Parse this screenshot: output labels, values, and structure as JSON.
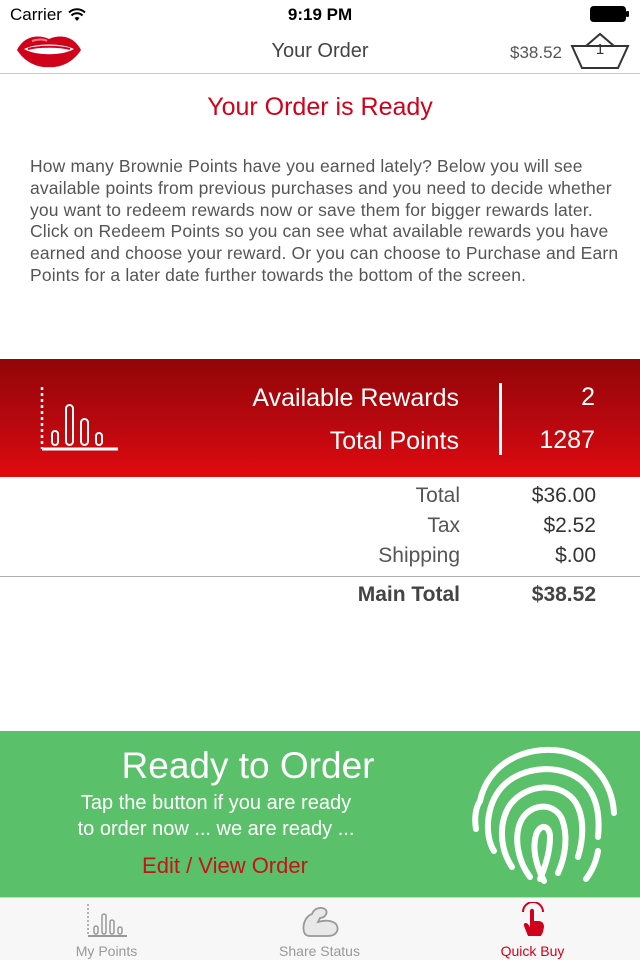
{
  "status_bar": {
    "carrier": "Carrier",
    "time": "9:19 PM"
  },
  "nav": {
    "title": "Your Order",
    "price": "$38.52",
    "cart_count": "1"
  },
  "heading": "Your Order is Ready",
  "intro": "How many Brownie Points have you earned lately? Below you will see available points from previous purchases and you need to decide whether you want to redeem rewards now or save them for bigger rewards later. Click on Redeem Points so you can see what available rewards you have earned and choose your reward. Or you can choose to Purchase and Earn Points for a later date further towards the bottom of the screen.",
  "rewards": {
    "available_label": "Available Rewards",
    "available_value": "2",
    "points_label": "Total Points",
    "points_value": "1287"
  },
  "summary": {
    "total_label": "Total",
    "total_value": "$36.00",
    "tax_label": "Tax",
    "tax_value": "$2.52",
    "shipping_label": "Shipping",
    "shipping_value": "$.00",
    "main_total_label": "Main Total",
    "main_total_value": "$38.52"
  },
  "order": {
    "title": "Ready to Order",
    "subtitle_line1": "Tap the button if you are ready",
    "subtitle_line2": "to order now ... we are ready ...",
    "edit_link": "Edit / View Order"
  },
  "tabs": [
    {
      "label": "My Points",
      "icon": "bar-chart-icon",
      "active": false
    },
    {
      "label": "Share Status",
      "icon": "flexed-arm-icon",
      "active": false
    },
    {
      "label": "Quick Buy",
      "icon": "tap-hand-icon",
      "active": true
    }
  ],
  "colors": {
    "brand_red": "#d0021b",
    "banner_dark": "#920508",
    "banner_light": "#e00a10",
    "order_green": "#5ac16a"
  }
}
